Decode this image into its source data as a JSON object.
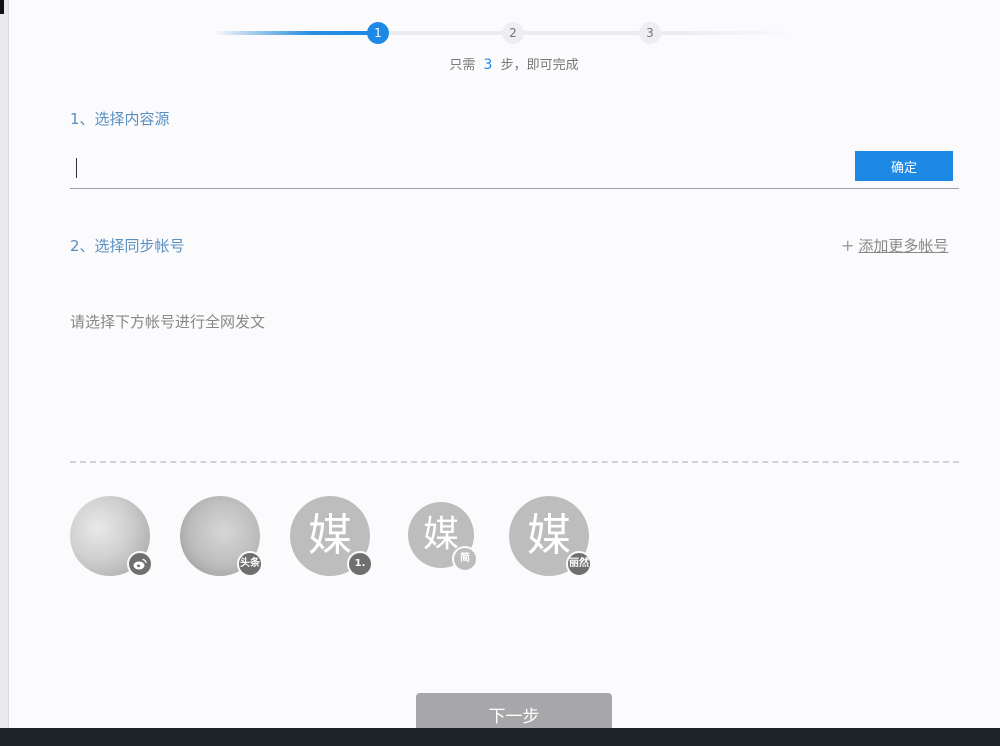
{
  "stepper": {
    "steps": [
      "1",
      "2",
      "3"
    ],
    "current_step": 1,
    "hint_prefix": "只需",
    "hint_number": "3",
    "hint_suffix": "步，即可完成"
  },
  "section1": {
    "title": "1、选择内容源",
    "input_value": "",
    "confirm_label": "确定"
  },
  "section2": {
    "title": "2、选择同步帐号",
    "add_more_label": "添加更多帐号",
    "placeholder_text": "请选择下方帐号进行全网发文"
  },
  "accounts": [
    {
      "avatar": "photo",
      "badge": "weibo-icon"
    },
    {
      "avatar": "photo",
      "badge": "头条"
    },
    {
      "avatar": "媒",
      "badge": "1."
    },
    {
      "avatar": "媒",
      "badge": "简"
    },
    {
      "avatar": "媒",
      "badge": "丽然"
    }
  ],
  "footer": {
    "next_label": "下一步"
  },
  "colors": {
    "accent": "#1e88e5",
    "section_title": "#5a8fc2",
    "next_button": "#a7a7aa"
  }
}
